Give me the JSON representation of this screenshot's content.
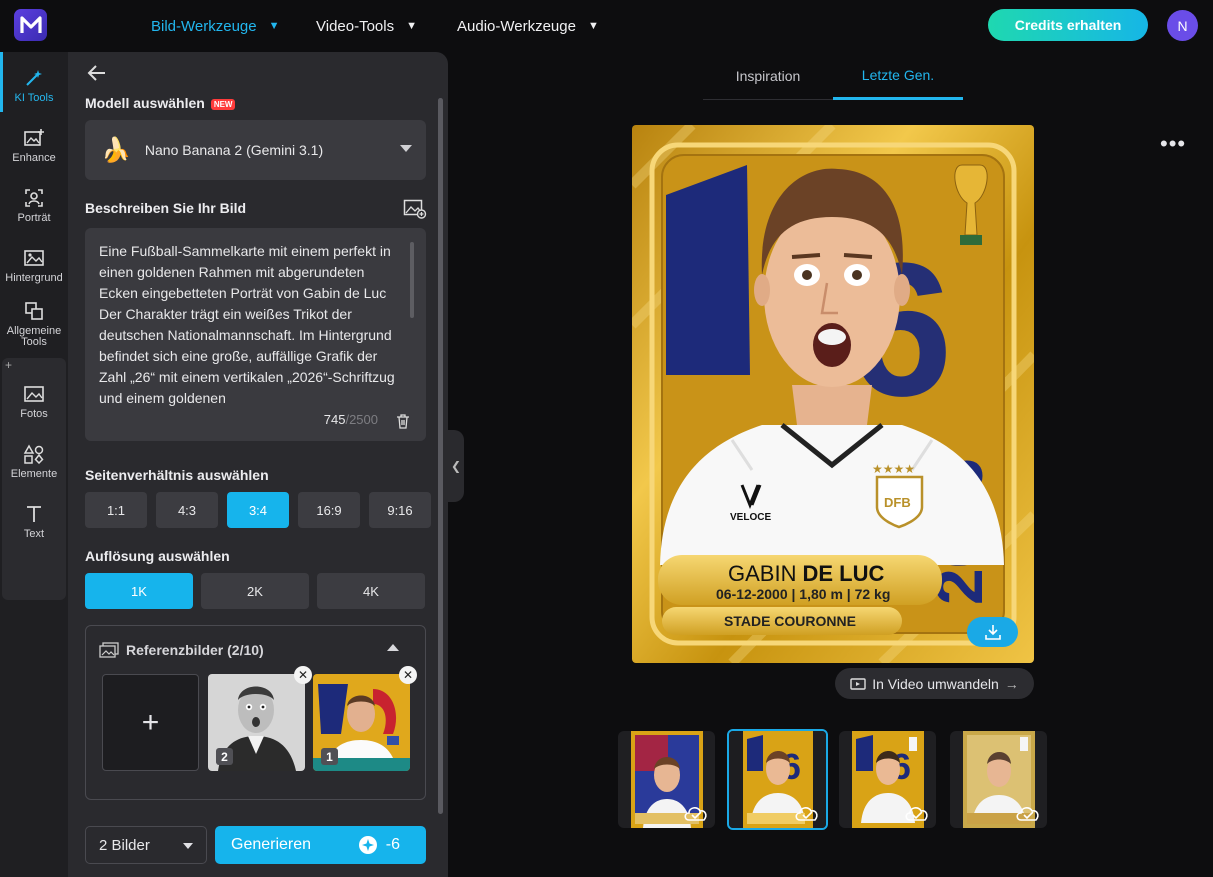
{
  "topbar": {
    "logo_letter": "M",
    "nav": [
      {
        "label": "Bild-Werkzeuge",
        "active": true
      },
      {
        "label": "Video-Tools",
        "active": false
      },
      {
        "label": "Audio-Werkzeuge",
        "active": false
      }
    ],
    "credits_button": "Credits erhalten",
    "avatar_initial": "N"
  },
  "rail": {
    "items": [
      {
        "label": "KI Tools",
        "icon": "magic-wand-icon",
        "active": true
      },
      {
        "label": "Enhance",
        "icon": "image-enhance-icon"
      },
      {
        "label": "Porträt",
        "icon": "portrait-icon"
      },
      {
        "label": "Hintergrund",
        "icon": "background-icon"
      },
      {
        "label": "Allgemeine Tools",
        "icon": "general-tools-icon"
      },
      {
        "label": "Fotos",
        "icon": "photos-icon"
      },
      {
        "label": "Elemente",
        "icon": "elements-icon"
      },
      {
        "label": "Text",
        "icon": "text-icon"
      }
    ],
    "plus": "+"
  },
  "panel": {
    "model_heading": "Modell auswählen",
    "new_badge": "NEW",
    "model_emoji": "🍌",
    "model_name": "Nano Banana 2 (Gemini 3.1)",
    "describe_heading": "Beschreiben Sie Ihr Bild",
    "prompt_text": "Eine Fußball-Sammelkarte mit einem perfekt in einen goldenen Rahmen mit abgerundeten Ecken eingebetteten Porträt von Gabin de Luc Der Charakter trägt ein weißes Trikot der deutschen Nationalmannschaft. Im Hintergrund befindet sich eine große, auffällige Grafik der Zahl „26“ mit einem vertikalen „2026“-Schriftzug und einem goldenen",
    "char_count": "745",
    "char_max": "/2500",
    "ratio_heading": "Seitenverhältnis auswählen",
    "ratios": [
      {
        "label": "1:1",
        "on": false
      },
      {
        "label": "4:3",
        "on": false
      },
      {
        "label": "3:4",
        "on": true
      },
      {
        "label": "16:9",
        "on": false
      },
      {
        "label": "9:16",
        "on": false
      }
    ],
    "resolution_heading": "Auflösung auswählen",
    "resolutions": [
      {
        "label": "1K",
        "on": true
      },
      {
        "label": "2K",
        "on": false
      },
      {
        "label": "4K",
        "on": false
      }
    ],
    "reference": {
      "title": "Referenzbilder (2/10)",
      "add_symbol": "+",
      "images": [
        {
          "number": "2"
        },
        {
          "number": "1"
        }
      ],
      "remove_symbol": "✕"
    },
    "image_count": "2 Bilder",
    "generate_label": "Generieren",
    "generate_cost": "-6"
  },
  "preview": {
    "tabs": [
      {
        "label": "Inspiration",
        "active": false
      },
      {
        "label": "Letzte Gen.",
        "active": true
      }
    ],
    "more": "•••",
    "to_video": "In Video umwandeln",
    "to_video_arrow": "→",
    "card": {
      "first_name": "GABIN",
      "last_name": "DE LUC",
      "details": "06-12-2000 | 1,80 m | 72 kg",
      "club": "STADE COURONNE",
      "big_number": "26",
      "year": "2026",
      "brand": "VELOCE",
      "crest": "DFB"
    },
    "thumbnails": 4
  },
  "colors": {
    "accent": "#16b4ec",
    "panel": "#2a2a2e",
    "gold": "#d9a316",
    "navy": "#1d2a7a"
  }
}
